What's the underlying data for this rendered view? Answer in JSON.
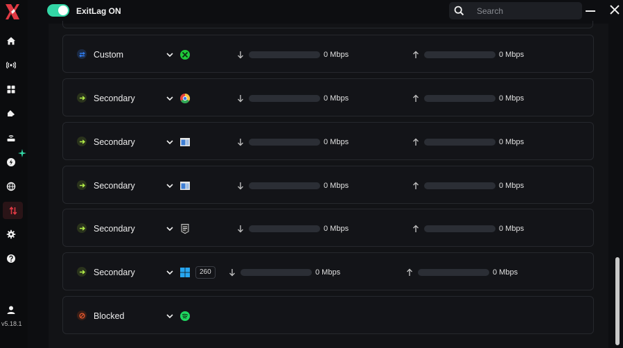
{
  "app": {
    "version": "v5.18.1"
  },
  "header": {
    "toggle_label": "ExitLag ON",
    "toggle_on": true,
    "search_placeholder": "Search"
  },
  "colors": {
    "accent_green": "#33d6a6",
    "brand_red": "#e03a44",
    "secondary_arrow": "#b6f24a",
    "custom_arrow": "#2f7cf0",
    "blocked": "#e4572e"
  },
  "nav": [
    {
      "icon": "home-icon"
    },
    {
      "icon": "broadcast-icon"
    },
    {
      "icon": "apps-grid-icon"
    },
    {
      "icon": "gamepad-icon"
    },
    {
      "icon": "router-icon"
    },
    {
      "icon": "boost-icon"
    },
    {
      "icon": "globe-icon"
    },
    {
      "icon": "traffic-split-icon",
      "active": true
    },
    {
      "icon": "settings-icon"
    },
    {
      "icon": "help-icon"
    },
    {
      "icon": "user-icon"
    }
  ],
  "rows": [
    {
      "type": "custom",
      "label": "Custom",
      "app_icon": "xbox-app-icon",
      "download": "0 Mbps",
      "upload": "0 Mbps"
    },
    {
      "type": "secondary",
      "label": "Secondary",
      "app_icon": "chrome-app-icon",
      "download": "0 Mbps",
      "upload": "0 Mbps"
    },
    {
      "type": "secondary",
      "label": "Secondary",
      "app_icon": "window-app-icon",
      "download": "0 Mbps",
      "upload": "0 Mbps"
    },
    {
      "type": "secondary",
      "label": "Secondary",
      "app_icon": "window-app-icon",
      "download": "0 Mbps",
      "upload": "0 Mbps"
    },
    {
      "type": "secondary",
      "label": "Secondary",
      "app_icon": "epic-games-app-icon",
      "download": "0 Mbps",
      "upload": "0 Mbps"
    },
    {
      "type": "secondary",
      "label": "Secondary",
      "app_icon": "windows-app-icon",
      "badge": "260",
      "download": "0 Mbps",
      "upload": "0 Mbps"
    },
    {
      "type": "blocked",
      "label": "Blocked",
      "app_icon": "spotify-app-icon"
    }
  ]
}
